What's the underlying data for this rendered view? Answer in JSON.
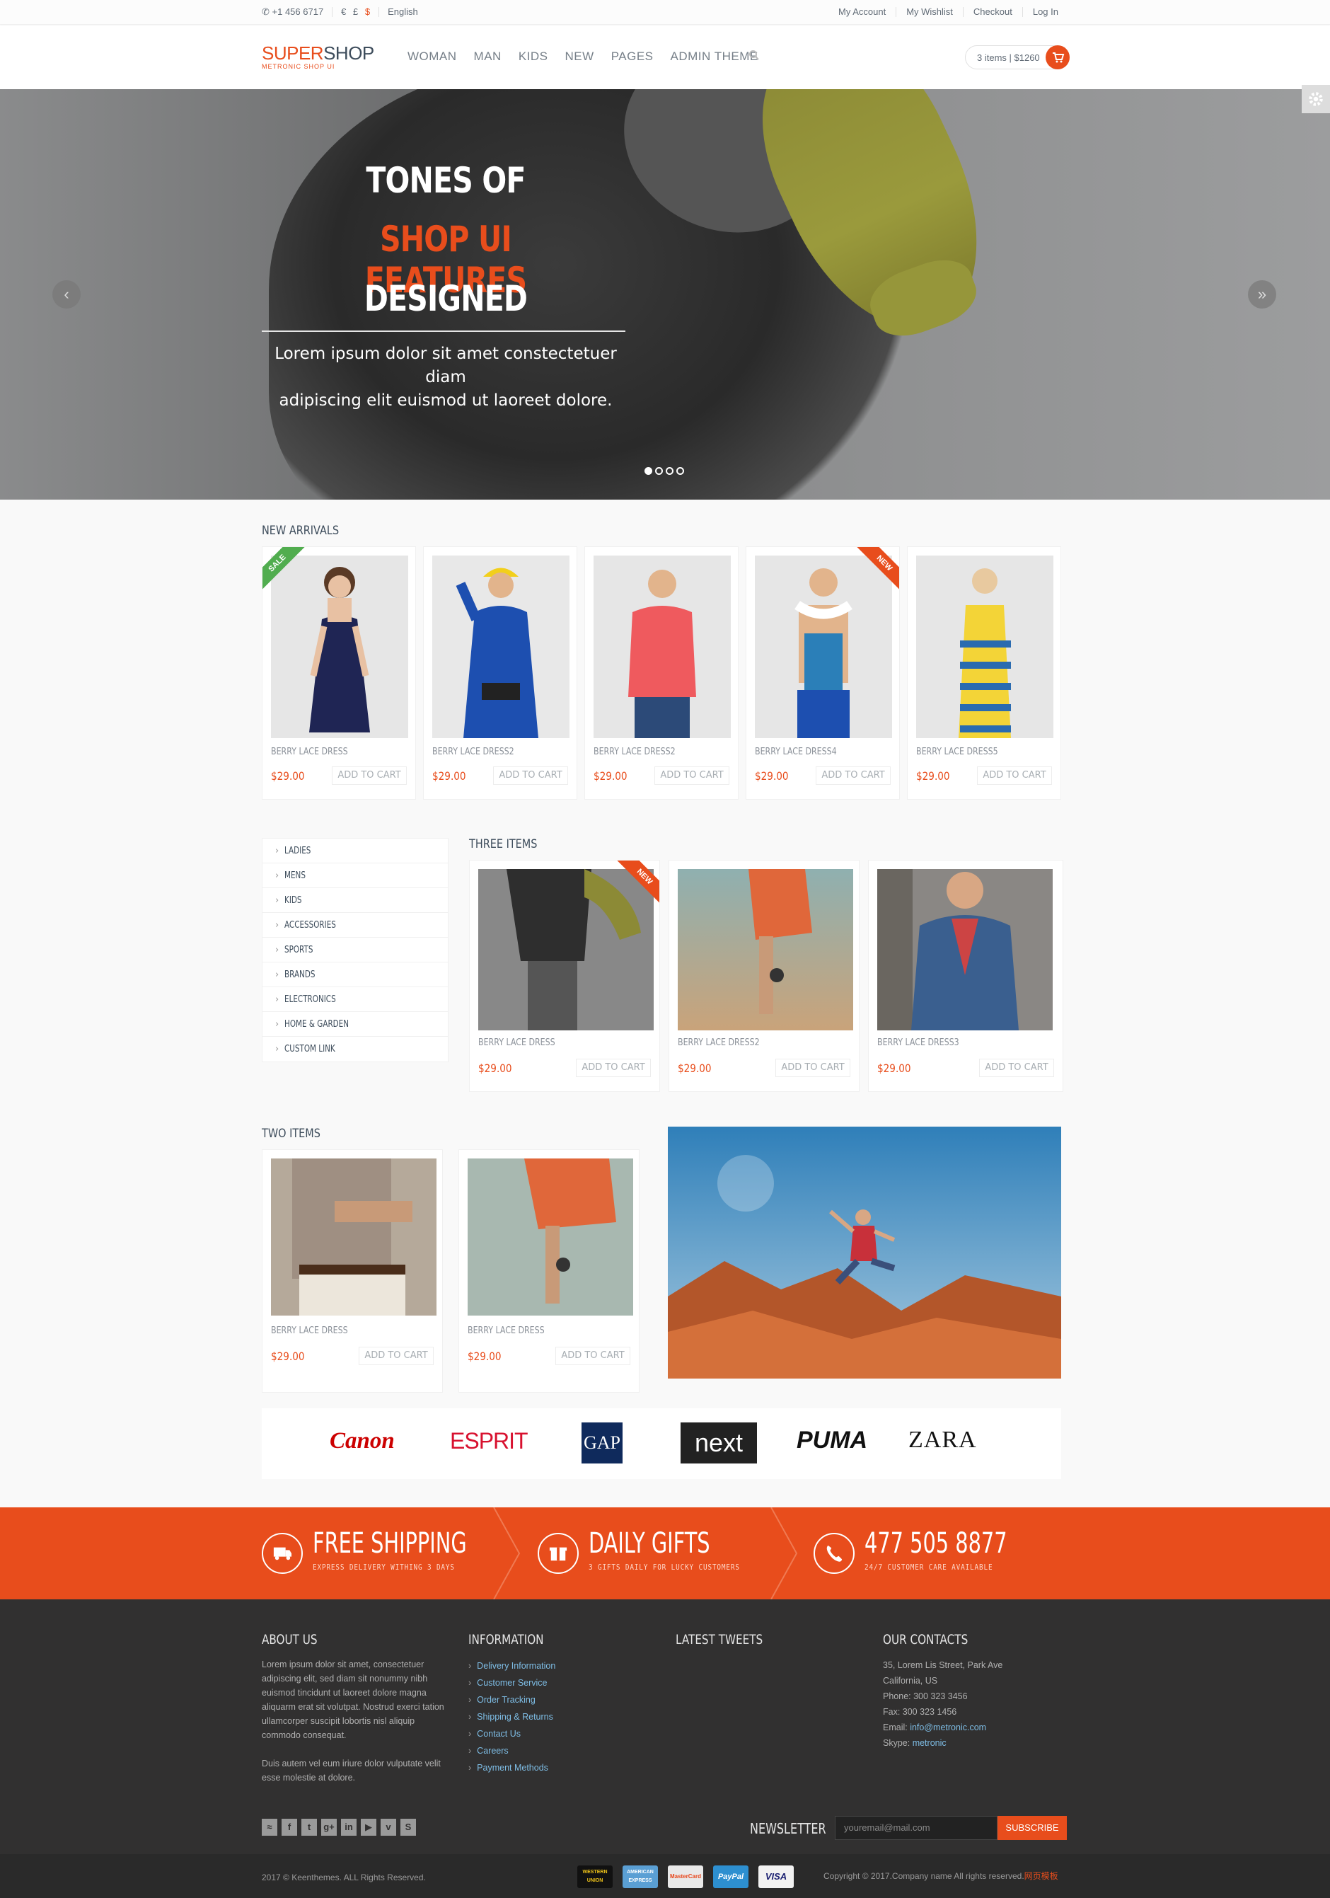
{
  "topbar": {
    "phone": "+1 456 6717",
    "currencies": [
      "€",
      "£",
      "$"
    ],
    "language": "English",
    "links": [
      "My Account",
      "My Wishlist",
      "Checkout",
      "Log In"
    ]
  },
  "header": {
    "logo_super": "SUPER",
    "logo_shop": "SHOP",
    "logo_sub": "METRONIC SHOP UI",
    "nav": [
      "WOMAN",
      "MAN",
      "KIDS",
      "NEW",
      "PAGES",
      "ADMIN THEME"
    ],
    "cart_text": "3 items | $1260"
  },
  "hero": {
    "line1": "TONES OF",
    "line2": "SHOP UI FEATURES",
    "line3": "DESIGNED",
    "desc1": "Lorem ipsum dolor sit amet constectetuer diam",
    "desc2": "adipiscing elit euismod ut laoreet dolore.",
    "prev": "‹",
    "next": "»",
    "slides": 4,
    "active_slide": 1
  },
  "new_arrivals": {
    "title": "NEW ARRIVALS",
    "items": [
      {
        "name": "BERRY LACE DRESS",
        "price": "$29.00",
        "add": "ADD TO CART",
        "badge": "SALE"
      },
      {
        "name": "BERRY LACE DRESS2",
        "price": "$29.00",
        "add": "ADD TO CART",
        "badge": ""
      },
      {
        "name": "BERRY LACE DRESS2",
        "price": "$29.00",
        "add": "ADD TO CART",
        "badge": ""
      },
      {
        "name": "BERRY LACE DRESS4",
        "price": "$29.00",
        "add": "ADD TO CART",
        "badge": "NEW"
      },
      {
        "name": "BERRY LACE DRESS5",
        "price": "$29.00",
        "add": "ADD TO CART",
        "badge": ""
      }
    ]
  },
  "sidebar": {
    "items": [
      "LADIES",
      "MENS",
      "KIDS",
      "ACCESSORIES",
      "SPORTS",
      "BRANDS",
      "ELECTRONICS",
      "HOME & GARDEN",
      "CUSTOM LINK"
    ]
  },
  "three_items": {
    "title": "THREE ITEMS",
    "items": [
      {
        "name": "BERRY LACE DRESS",
        "price": "$29.00",
        "add": "ADD TO CART",
        "badge": "NEW"
      },
      {
        "name": "BERRY LACE DRESS2",
        "price": "$29.00",
        "add": "ADD TO CART",
        "badge": ""
      },
      {
        "name": "BERRY LACE DRESS3",
        "price": "$29.00",
        "add": "ADD TO CART",
        "badge": ""
      }
    ]
  },
  "two_items": {
    "title": "TWO ITEMS",
    "items": [
      {
        "name": "BERRY LACE DRESS",
        "price": "$29.00",
        "add": "ADD TO CART"
      },
      {
        "name": "BERRY LACE DRESS",
        "price": "$29.00",
        "add": "ADD TO CART"
      }
    ]
  },
  "brands": [
    "Canon",
    "ESPRIT",
    "GAP",
    "next",
    "PUMA",
    "ZARA"
  ],
  "steps": [
    {
      "title": "FREE SHIPPING",
      "sub": "EXPRESS DELIVERY WITHING 3 DAYS"
    },
    {
      "title": "DAILY GIFTS",
      "sub": "3 GIFTS DAILY FOR LUCKY CUSTOMERS"
    },
    {
      "title": "477 505 8877",
      "sub": "24/7 CUSTOMER CARE AVAILABLE"
    }
  ],
  "footer": {
    "about_title": "ABOUT US",
    "about_p1": "Lorem ipsum dolor sit amet, consectetuer adipiscing elit, sed diam sit nonummy nibh euismod tincidunt ut laoreet dolore magna aliquarm erat sit volutpat. Nostrud exerci tation ullamcorper suscipit lobortis nisl aliquip commodo consequat.",
    "about_p2": "Duis autem vel eum iriure dolor vulputate velit esse molestie at dolore.",
    "info_title": "INFORMATION",
    "info_links": [
      "Delivery Information",
      "Customer Service",
      "Order Tracking",
      "Shipping & Returns",
      "Contact Us",
      "Careers",
      "Payment Methods"
    ],
    "tweets_title": "LATEST TWEETS",
    "contacts_title": "OUR CONTACTS",
    "address1": "35, Lorem Lis Street, Park Ave",
    "address2": "California, US",
    "phone": "Phone: 300 323 3456",
    "fax": "Fax: 300 323 1456",
    "email_label": "Email: ",
    "email": "info@metronic.com",
    "skype_label": "Skype: ",
    "skype": "metronic",
    "social": [
      "rss",
      "f",
      "t",
      "g+",
      "in",
      "yt",
      "v",
      "s"
    ],
    "newsletter_label": "NEWSLETTER",
    "newsletter_placeholder": "youremail@mail.com",
    "subscribe": "SUBSCRIBE",
    "copyright": "2017 © Keenthemes. ALL Rights Reserved.",
    "copyright_right": "Copyright © 2017.Company name All rights reserved.",
    "copyright_extra": "网页模板",
    "payments": [
      "WESTERN UNION",
      "AMERICAN EXPRESS",
      "MasterCard",
      "PayPal",
      "VISA"
    ]
  },
  "colors": {
    "accent": "#e84d1c",
    "text": "#3e4d5c",
    "footer": "#313030"
  }
}
